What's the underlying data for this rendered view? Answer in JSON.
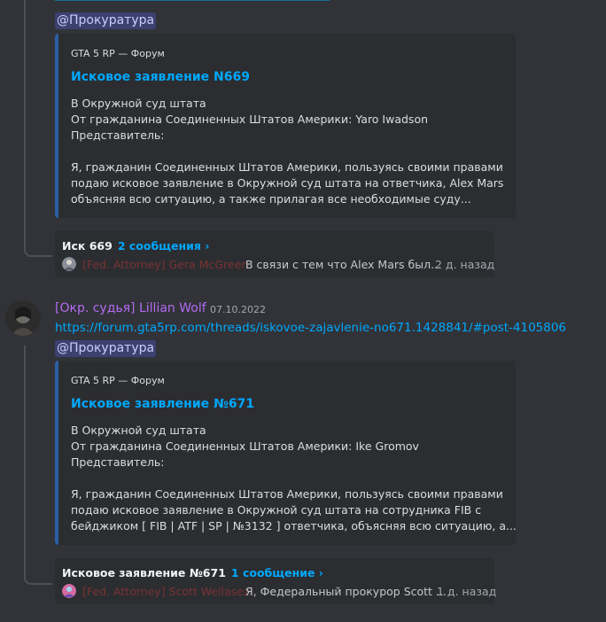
{
  "message1": {
    "mention": "@Прокуратура",
    "embed": {
      "provider": "GTA 5 RP — Форум",
      "title": "Исковое заявление N669",
      "lines": [
        "В Окружной суд штата",
        "От гражданина Соединенных Штатов Америки: Yaro Iwadson",
        "Представитель:",
        "",
        "Я, гражданин Соединенных Штатов Америки, пользуясь своими правами",
        "подаю исковое заявление в Окружной суд штата на ответчика, Alex Mars",
        "объясняя всю ситуацию, а также прилагая все необходимые суду..."
      ]
    },
    "thread": {
      "title": "Иск 669",
      "count": "2 сообщения ›",
      "author": "[Fed. Attorney] Gera McGreen",
      "preview": "В связи с тем что Alex Mars был...",
      "time": "2 д. назад"
    }
  },
  "message2": {
    "author": "[Окр. судья] Lillian Wolf",
    "timestamp": "07.10.2022",
    "link": "https://forum.gta5rp.com/threads/iskovoe-zajavlenie-no671.1428841/#post-4105806",
    "mention": "@Прокуратура",
    "embed": {
      "provider": "GTA 5 RP — Форум",
      "title": "Исковое заявление №671",
      "lines": [
        "В Окружной суд штата",
        "От гражданина Соединенных Штатов Америки: Ike Gromov",
        "Представитель:",
        "",
        "Я, гражданин Соединенных Штатов Америки, пользуясь своими правами",
        "подаю исковое заявление в Окружной суд штата на сотрудника FIB с",
        "бейджиком [ FIB | ATF | SP | №3132 ] ответчика, объясняя всю ситуацию, а..."
      ]
    },
    "thread": {
      "title": "Исковое заявление №671",
      "count": "1 сообщение ›",
      "author": "[Fed. Attorney] Scott Wellasez",
      "preview": "Я, Федеральный прокурор Scott ...",
      "time": "1 д. назад"
    }
  },
  "colors": {
    "background": "#313338",
    "embed_bg": "#2b2d31",
    "embed_accent": "#2a5fa6",
    "link": "#00a8fc",
    "author_role": "#b36af2",
    "thread_author": "#7a3232"
  }
}
